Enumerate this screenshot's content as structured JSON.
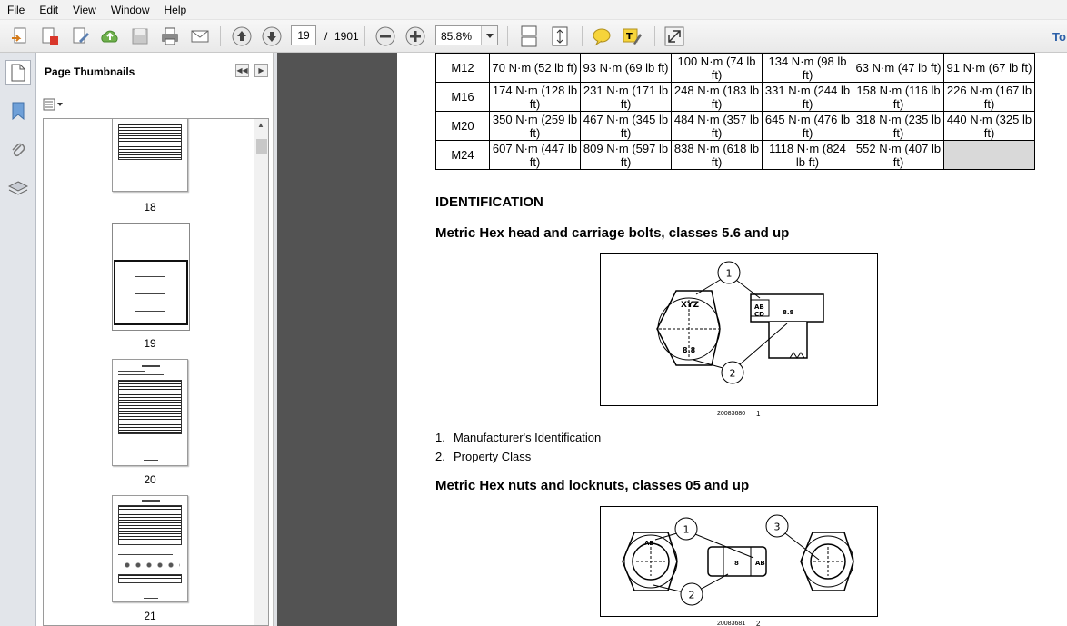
{
  "menu": [
    "File",
    "Edit",
    "View",
    "Window",
    "Help"
  ],
  "toolbar": {
    "page_current": "19",
    "page_separator": "/",
    "page_total": "1901",
    "zoom": "85.8%",
    "tools_label": "To"
  },
  "panel": {
    "title": "Page Thumbnails",
    "thumbnails": [
      {
        "label": "18"
      },
      {
        "label": "19"
      },
      {
        "label": "20"
      },
      {
        "label": "21"
      }
    ]
  },
  "document": {
    "table_rows": [
      [
        "M12",
        "70 N·m (52 lb ft)",
        "93 N·m (69 lb ft)",
        "100 N·m (74 lb ft)",
        "134 N·m (98 lb ft)",
        "63 N·m (47 lb ft)",
        "91 N·m (67 lb ft)"
      ],
      [
        "M16",
        "174 N·m (128 lb ft)",
        "231 N·m (171 lb ft)",
        "248 N·m (183 lb ft)",
        "331 N·m (244 lb ft)",
        "158 N·m (116 lb ft)",
        "226 N·m (167 lb ft)"
      ],
      [
        "M20",
        "350 N·m (259 lb ft)",
        "467 N·m (345 lb ft)",
        "484 N·m (357 lb ft)",
        "645 N·m (476 lb ft)",
        "318 N·m (235 lb ft)",
        "440 N·m (325 lb ft)"
      ],
      [
        "M24",
        "607 N·m (447 lb ft)",
        "809 N·m (597 lb ft)",
        "838 N·m (618 lb ft)",
        "1118 N·m (824 lb ft)",
        "552 N·m (407 lb ft)",
        ""
      ]
    ],
    "section_heading": "IDENTIFICATION",
    "bolts_heading": "Metric Hex head and carriage bolts, classes 5.6 and up",
    "figure1": {
      "code": "20083680",
      "number": "1",
      "callout1": "1",
      "callout2": "2",
      "head_mark": "XYZ",
      "class_mark": "8.8",
      "side_mark_ab": "AB",
      "side_mark_cd": "CD"
    },
    "legend": [
      {
        "num": "1.",
        "text": "Manufacturer's Identification"
      },
      {
        "num": "2.",
        "text": "Property Class"
      }
    ],
    "nuts_heading": "Metric Hex nuts and locknuts, classes 05 and up",
    "figure2": {
      "code": "20083681",
      "number": "2",
      "callout1": "1",
      "callout2": "2",
      "callout3": "3",
      "nut_mark": "AB",
      "nut_class": "8"
    }
  }
}
